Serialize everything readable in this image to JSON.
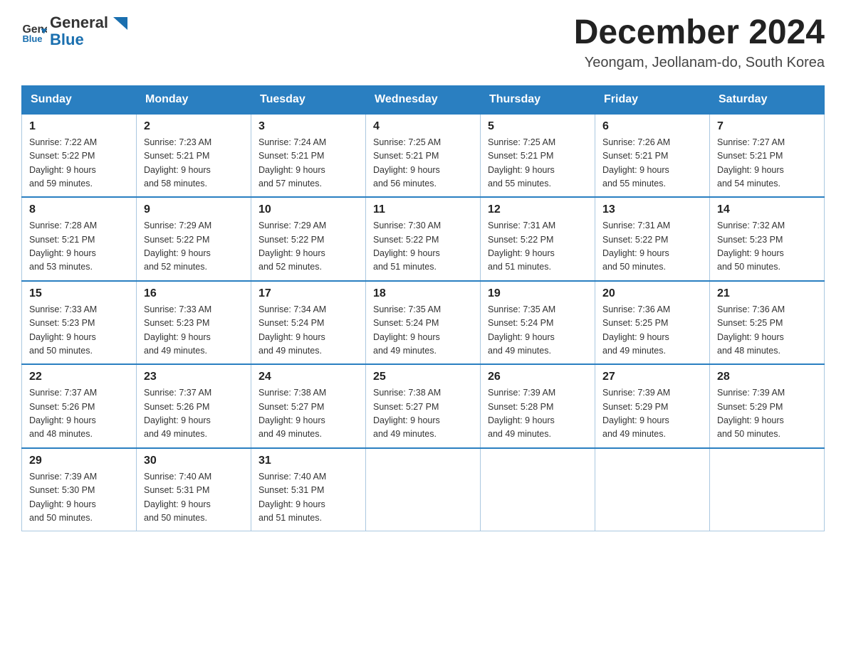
{
  "header": {
    "logo_general": "General",
    "logo_blue": "Blue",
    "month_title": "December 2024",
    "location": "Yeongam, Jeollanam-do, South Korea"
  },
  "weekdays": [
    "Sunday",
    "Monday",
    "Tuesday",
    "Wednesday",
    "Thursday",
    "Friday",
    "Saturday"
  ],
  "weeks": [
    [
      {
        "day": "1",
        "sunrise": "7:22 AM",
        "sunset": "5:22 PM",
        "daylight": "9 hours and 59 minutes."
      },
      {
        "day": "2",
        "sunrise": "7:23 AM",
        "sunset": "5:21 PM",
        "daylight": "9 hours and 58 minutes."
      },
      {
        "day": "3",
        "sunrise": "7:24 AM",
        "sunset": "5:21 PM",
        "daylight": "9 hours and 57 minutes."
      },
      {
        "day": "4",
        "sunrise": "7:25 AM",
        "sunset": "5:21 PM",
        "daylight": "9 hours and 56 minutes."
      },
      {
        "day": "5",
        "sunrise": "7:25 AM",
        "sunset": "5:21 PM",
        "daylight": "9 hours and 55 minutes."
      },
      {
        "day": "6",
        "sunrise": "7:26 AM",
        "sunset": "5:21 PM",
        "daylight": "9 hours and 55 minutes."
      },
      {
        "day": "7",
        "sunrise": "7:27 AM",
        "sunset": "5:21 PM",
        "daylight": "9 hours and 54 minutes."
      }
    ],
    [
      {
        "day": "8",
        "sunrise": "7:28 AM",
        "sunset": "5:21 PM",
        "daylight": "9 hours and 53 minutes."
      },
      {
        "day": "9",
        "sunrise": "7:29 AM",
        "sunset": "5:22 PM",
        "daylight": "9 hours and 52 minutes."
      },
      {
        "day": "10",
        "sunrise": "7:29 AM",
        "sunset": "5:22 PM",
        "daylight": "9 hours and 52 minutes."
      },
      {
        "day": "11",
        "sunrise": "7:30 AM",
        "sunset": "5:22 PM",
        "daylight": "9 hours and 51 minutes."
      },
      {
        "day": "12",
        "sunrise": "7:31 AM",
        "sunset": "5:22 PM",
        "daylight": "9 hours and 51 minutes."
      },
      {
        "day": "13",
        "sunrise": "7:31 AM",
        "sunset": "5:22 PM",
        "daylight": "9 hours and 50 minutes."
      },
      {
        "day": "14",
        "sunrise": "7:32 AM",
        "sunset": "5:23 PM",
        "daylight": "9 hours and 50 minutes."
      }
    ],
    [
      {
        "day": "15",
        "sunrise": "7:33 AM",
        "sunset": "5:23 PM",
        "daylight": "9 hours and 50 minutes."
      },
      {
        "day": "16",
        "sunrise": "7:33 AM",
        "sunset": "5:23 PM",
        "daylight": "9 hours and 49 minutes."
      },
      {
        "day": "17",
        "sunrise": "7:34 AM",
        "sunset": "5:24 PM",
        "daylight": "9 hours and 49 minutes."
      },
      {
        "day": "18",
        "sunrise": "7:35 AM",
        "sunset": "5:24 PM",
        "daylight": "9 hours and 49 minutes."
      },
      {
        "day": "19",
        "sunrise": "7:35 AM",
        "sunset": "5:24 PM",
        "daylight": "9 hours and 49 minutes."
      },
      {
        "day": "20",
        "sunrise": "7:36 AM",
        "sunset": "5:25 PM",
        "daylight": "9 hours and 49 minutes."
      },
      {
        "day": "21",
        "sunrise": "7:36 AM",
        "sunset": "5:25 PM",
        "daylight": "9 hours and 48 minutes."
      }
    ],
    [
      {
        "day": "22",
        "sunrise": "7:37 AM",
        "sunset": "5:26 PM",
        "daylight": "9 hours and 48 minutes."
      },
      {
        "day": "23",
        "sunrise": "7:37 AM",
        "sunset": "5:26 PM",
        "daylight": "9 hours and 49 minutes."
      },
      {
        "day": "24",
        "sunrise": "7:38 AM",
        "sunset": "5:27 PM",
        "daylight": "9 hours and 49 minutes."
      },
      {
        "day": "25",
        "sunrise": "7:38 AM",
        "sunset": "5:27 PM",
        "daylight": "9 hours and 49 minutes."
      },
      {
        "day": "26",
        "sunrise": "7:39 AM",
        "sunset": "5:28 PM",
        "daylight": "9 hours and 49 minutes."
      },
      {
        "day": "27",
        "sunrise": "7:39 AM",
        "sunset": "5:29 PM",
        "daylight": "9 hours and 49 minutes."
      },
      {
        "day": "28",
        "sunrise": "7:39 AM",
        "sunset": "5:29 PM",
        "daylight": "9 hours and 50 minutes."
      }
    ],
    [
      {
        "day": "29",
        "sunrise": "7:39 AM",
        "sunset": "5:30 PM",
        "daylight": "9 hours and 50 minutes."
      },
      {
        "day": "30",
        "sunrise": "7:40 AM",
        "sunset": "5:31 PM",
        "daylight": "9 hours and 50 minutes."
      },
      {
        "day": "31",
        "sunrise": "7:40 AM",
        "sunset": "5:31 PM",
        "daylight": "9 hours and 51 minutes."
      },
      null,
      null,
      null,
      null
    ]
  ],
  "labels": {
    "sunrise": "Sunrise:",
    "sunset": "Sunset:",
    "daylight": "Daylight:"
  }
}
